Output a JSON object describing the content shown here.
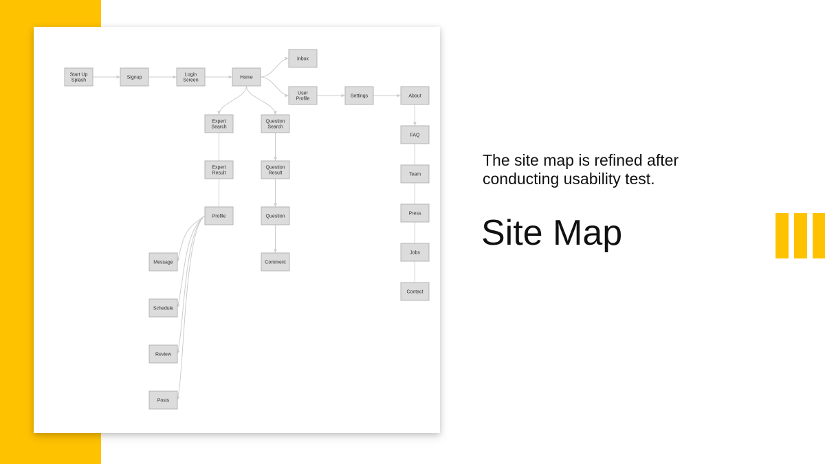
{
  "colors": {
    "accent": "#FFC200",
    "node_fill": "#dcdcdc",
    "node_stroke": "#b4b4b4",
    "edge": "#cccccc"
  },
  "caption": "The site map is refined after conducting usability test.",
  "title": "Site Map",
  "sitemap": {
    "nodes": [
      {
        "id": "start",
        "label": [
          "Start Up",
          "Splash"
        ]
      },
      {
        "id": "signup",
        "label": [
          "Signup"
        ]
      },
      {
        "id": "login",
        "label": [
          "Login",
          "Screen"
        ]
      },
      {
        "id": "home",
        "label": [
          "Home"
        ]
      },
      {
        "id": "inbox",
        "label": [
          "Inbox"
        ]
      },
      {
        "id": "userprofile",
        "label": [
          "User",
          "Profile"
        ]
      },
      {
        "id": "settings",
        "label": [
          "Settings"
        ]
      },
      {
        "id": "about",
        "label": [
          "About"
        ]
      },
      {
        "id": "faq",
        "label": [
          "FAQ"
        ]
      },
      {
        "id": "team",
        "label": [
          "Team"
        ]
      },
      {
        "id": "press",
        "label": [
          "Press"
        ]
      },
      {
        "id": "jobs",
        "label": [
          "Jobs"
        ]
      },
      {
        "id": "contact",
        "label": [
          "Contact"
        ]
      },
      {
        "id": "expertsearch",
        "label": [
          "Expert",
          "Search"
        ]
      },
      {
        "id": "expertresult",
        "label": [
          "Expert",
          "Result"
        ]
      },
      {
        "id": "profile",
        "label": [
          "Profile"
        ]
      },
      {
        "id": "questionsearch",
        "label": [
          "Question",
          "Search"
        ]
      },
      {
        "id": "questionresult",
        "label": [
          "Question",
          "Result"
        ]
      },
      {
        "id": "question",
        "label": [
          "Question"
        ]
      },
      {
        "id": "comment",
        "label": [
          "Comment"
        ]
      },
      {
        "id": "message",
        "label": [
          "Message"
        ]
      },
      {
        "id": "schedule",
        "label": [
          "Schedule"
        ]
      },
      {
        "id": "review",
        "label": [
          "Review"
        ]
      },
      {
        "id": "posts",
        "label": [
          "Posts"
        ]
      }
    ],
    "edges": [
      [
        "start",
        "signup"
      ],
      [
        "signup",
        "login"
      ],
      [
        "login",
        "home"
      ],
      [
        "home",
        "inbox"
      ],
      [
        "home",
        "userprofile"
      ],
      [
        "userprofile",
        "settings"
      ],
      [
        "settings",
        "about"
      ],
      [
        "about",
        "faq"
      ],
      [
        "faq",
        "team"
      ],
      [
        "team",
        "press"
      ],
      [
        "press",
        "jobs"
      ],
      [
        "jobs",
        "contact"
      ],
      [
        "home",
        "expertsearch"
      ],
      [
        "home",
        "questionsearch"
      ],
      [
        "expertsearch",
        "expertresult"
      ],
      [
        "expertresult",
        "profile"
      ],
      [
        "questionsearch",
        "questionresult"
      ],
      [
        "questionresult",
        "question"
      ],
      [
        "question",
        "comment"
      ],
      [
        "profile",
        "message"
      ],
      [
        "profile",
        "schedule"
      ],
      [
        "profile",
        "review"
      ],
      [
        "profile",
        "posts"
      ]
    ]
  }
}
